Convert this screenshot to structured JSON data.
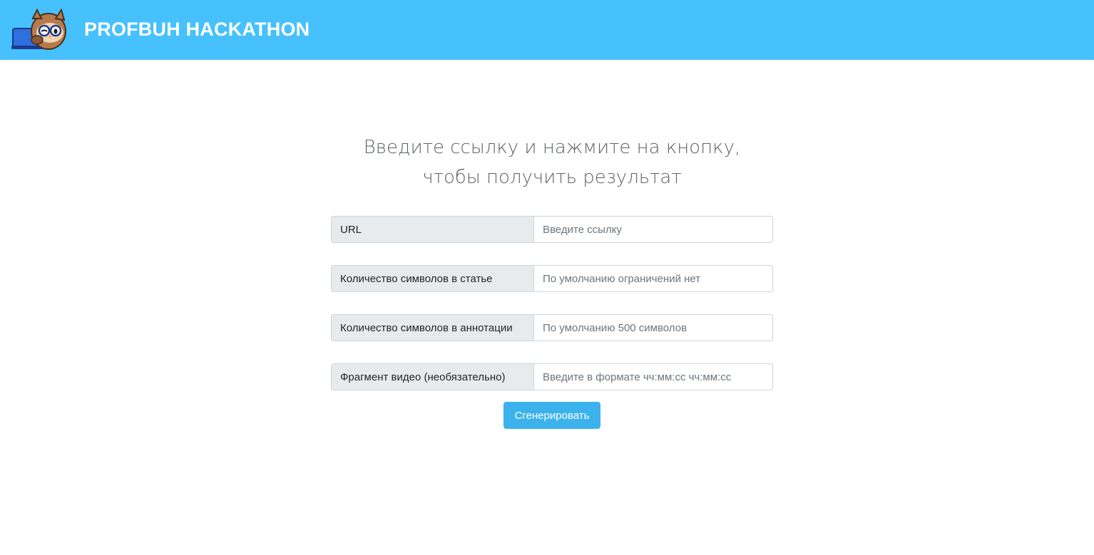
{
  "header": {
    "brand": "PROFBUH HACKATHON",
    "logo_icon": "owl-with-glasses-and-laptop-icon",
    "background": "#46c1fe"
  },
  "main": {
    "title": "Введите ссылку и нажмите на кнопку, чтобы получить результат",
    "fields": [
      {
        "label": "URL",
        "placeholder": "Введите ссылку",
        "value": ""
      },
      {
        "label": "Количество символов в статье",
        "placeholder": "По умолчанию ограничений нет",
        "value": ""
      },
      {
        "label": "Количество символов в аннотации",
        "placeholder": "По умолчанию 500 символов",
        "value": ""
      },
      {
        "label": "Фрагмент видео (необязательно)",
        "placeholder": "Введите в формате чч:мм:сс чч:мм:сс",
        "value": ""
      }
    ],
    "submit_label": "Сгенерировать",
    "button_color": "#3bb2ec"
  }
}
